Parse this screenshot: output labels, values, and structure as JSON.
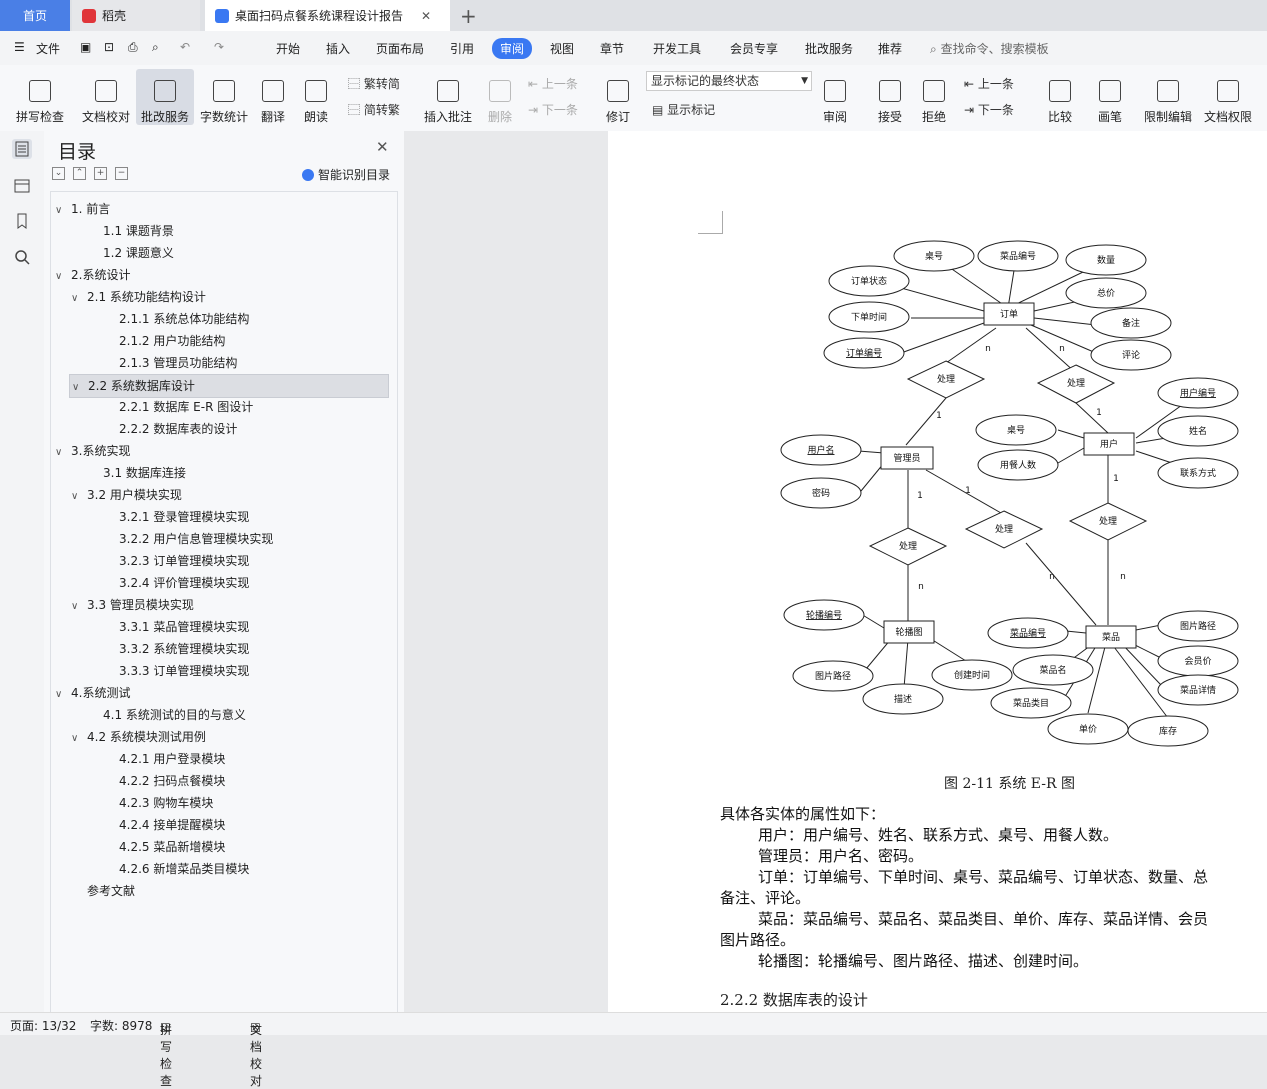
{
  "tabs": {
    "home": "首页",
    "daoke": "稻壳",
    "doc": "桌面扫码点餐系统课程设计报告"
  },
  "menu": {
    "file": "文件",
    "items": [
      "开始",
      "插入",
      "页面布局",
      "引用",
      "审阅",
      "视图",
      "章节",
      "开发工具",
      "会员专享",
      "批改服务",
      "推荐"
    ],
    "active": "审阅",
    "search": "查找命令、搜索模板"
  },
  "ribbon": {
    "spell": "拼写检查",
    "proof": "文档校对",
    "grading": "批改服务",
    "wordcount": "字数统计",
    "translate": "翻译",
    "read": "朗读",
    "trad": "繁转简",
    "simp": "简转繁",
    "comment": "插入批注",
    "delete": "删除",
    "prev_comment": "上一条",
    "next_comment": "下一条",
    "revise": "修订",
    "markup_state": "显示标记的最终状态",
    "show_markup": "显示标记",
    "review": "审阅",
    "accept": "接受",
    "reject": "拒绝",
    "prev": "上一条",
    "next": "下一条",
    "compare": "比较",
    "pen": "画笔",
    "restrict": "限制编辑",
    "perm": "文档权限"
  },
  "toc": {
    "title": "目录",
    "smart": "智能识别目录",
    "items": [
      {
        "text": "1.  前言",
        "level": 0,
        "arrow": "∨"
      },
      {
        "text": "1.1  课题背景",
        "level": 1,
        "arrow": ""
      },
      {
        "text": "1.2  课题意义",
        "level": 1,
        "arrow": ""
      },
      {
        "text": "2.系统设计",
        "level": 0,
        "arrow": "∨"
      },
      {
        "text": "2.1 系统功能结构设计",
        "level": 1,
        "arrow": "∨"
      },
      {
        "text": "2.1.1  系统总体功能结构",
        "level": 2,
        "arrow": ""
      },
      {
        "text": "2.1.2  用户功能结构",
        "level": 2,
        "arrow": ""
      },
      {
        "text": "2.1.3  管理员功能结构",
        "level": 2,
        "arrow": ""
      },
      {
        "text": "2.2  系统数据库设计",
        "level": 1,
        "arrow": "∨",
        "selected": true
      },
      {
        "text": "2.2.1  数据库 E-R 图设计",
        "level": 2,
        "arrow": ""
      },
      {
        "text": "2.2.2  数据库表的设计",
        "level": 2,
        "arrow": ""
      },
      {
        "text": "3.系统实现",
        "level": 0,
        "arrow": "∨"
      },
      {
        "text": "3.1 数据库连接",
        "level": 1,
        "arrow": ""
      },
      {
        "text": "3.2 用户模块实现",
        "level": 1,
        "arrow": "∨"
      },
      {
        "text": "3.2.1  登录管理模块实现",
        "level": 2,
        "arrow": ""
      },
      {
        "text": "3.2.2  用户信息管理模块实现",
        "level": 2,
        "arrow": ""
      },
      {
        "text": "3.2.3  订单管理模块实现",
        "level": 2,
        "arrow": ""
      },
      {
        "text": "3.2.4  评价管理模块实现",
        "level": 2,
        "arrow": ""
      },
      {
        "text": "3.3  管理员模块实现",
        "level": 1,
        "arrow": "∨"
      },
      {
        "text": "3.3.1  菜品管理模块实现",
        "level": 2,
        "arrow": ""
      },
      {
        "text": "3.3.2  系统管理模块实现",
        "level": 2,
        "arrow": ""
      },
      {
        "text": "3.3.3  订单管理模块实现",
        "level": 2,
        "arrow": ""
      },
      {
        "text": "4.系统测试",
        "level": 0,
        "arrow": "∨"
      },
      {
        "text": "4.1 系统测试的目的与意义",
        "level": 1,
        "arrow": ""
      },
      {
        "text": "4.2  系统模块测试用例",
        "level": 1,
        "arrow": "∨"
      },
      {
        "text": "4.2.1  用户登录模块",
        "level": 2,
        "arrow": ""
      },
      {
        "text": "4.2.2  扫码点餐模块",
        "level": 2,
        "arrow": ""
      },
      {
        "text": "4.2.3  购物车模块",
        "level": 2,
        "arrow": ""
      },
      {
        "text": "4.2.4  接单提醒模块",
        "level": 2,
        "arrow": ""
      },
      {
        "text": "4.2.5  菜品新增模块",
        "level": 2,
        "arrow": ""
      },
      {
        "text": "4.2.6  新增菜品类目模块",
        "level": 2,
        "arrow": ""
      },
      {
        "text": "参考文献",
        "level": 0,
        "arrow": ""
      }
    ]
  },
  "er": {
    "entities": [
      "订单",
      "管理员",
      "用户",
      "轮播图",
      "菜品"
    ],
    "relations": [
      "处理",
      "处理",
      "处理",
      "处理",
      "处理"
    ],
    "attrs": {
      "order": [
        "桌号",
        "菜品编号",
        "数量",
        "订单状态",
        "总价",
        "下单时间",
        "备注",
        "订单编号",
        "评论"
      ],
      "user": [
        "用户编号",
        "桌号",
        "姓名",
        "用餐人数",
        "联系方式"
      ],
      "admin": [
        "用户名",
        "密码"
      ],
      "carousel": [
        "轮播编号",
        "图片路径",
        "描述",
        "创建时间"
      ],
      "dish": [
        "菜品编号",
        "图片路径",
        "菜品名",
        "会员价",
        "菜品类目",
        "菜品详情",
        "单价",
        "库存"
      ]
    },
    "card": {
      "n": "n",
      "one": "1"
    }
  },
  "doc": {
    "caption": "图 2-11  系统 E-R 图",
    "lines": [
      "具体各实体的属性如下：",
      "用户：用户编号、姓名、联系方式、桌号、用餐人数。",
      "管理员：用户名、密码。",
      "订单：订单编号、下单时间、桌号、菜品编号、订单状态、数量、总",
      "备注、评论。",
      "菜品：菜品编号、菜品名、菜品类目、单价、库存、菜品详情、会员",
      "图片路径。",
      "轮播图：轮播编号、图片路径、描述、创建时间。"
    ],
    "heading": "2.2.2  数据库表的设计"
  },
  "status": {
    "page": "页面: 13/32",
    "words": "字数: 8978",
    "spell": "拼写检查",
    "proof": "文档校对"
  }
}
